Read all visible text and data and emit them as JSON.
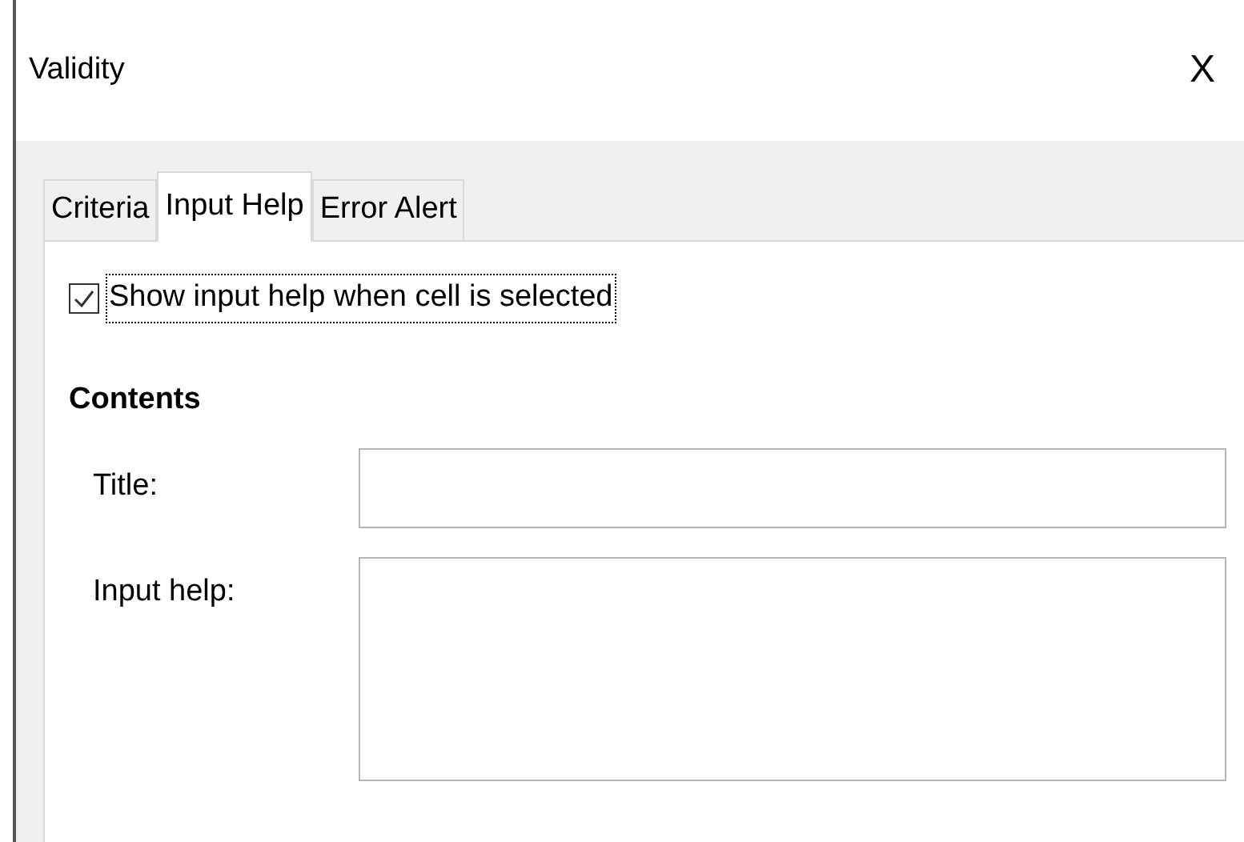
{
  "window": {
    "title": "Validity",
    "close": "X"
  },
  "tabs": [
    {
      "label": "Criteria",
      "selected": false
    },
    {
      "label": "Input Help",
      "selected": true
    },
    {
      "label": "Error Alert",
      "selected": false
    }
  ],
  "show_help": {
    "label": "Show input help when cell is selected",
    "checked": true
  },
  "contents": {
    "heading": "Contents",
    "fields": [
      {
        "kind": "line",
        "label": "Title:"
      },
      {
        "kind": "area",
        "label": "Input help:"
      }
    ]
  }
}
